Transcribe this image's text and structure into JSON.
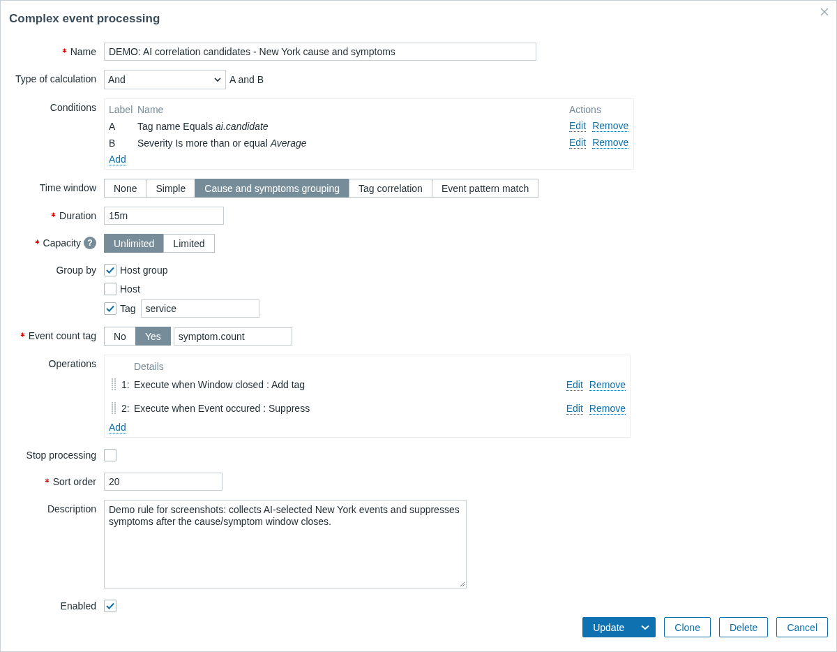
{
  "dialog": {
    "title": "Complex event processing"
  },
  "name": {
    "label": "Name",
    "required": true,
    "value": "DEMO: AI correlation candidates - New York cause and symptoms"
  },
  "calculation": {
    "label": "Type of calculation",
    "required": false,
    "value": "And",
    "formula": "A and B"
  },
  "conditions": {
    "label": "Conditions",
    "required": false,
    "columns": [
      "Label",
      "Name",
      "Actions"
    ],
    "rows": [
      {
        "label": "A",
        "name": "Tag name Equals *ai.candidate*",
        "actions": [
          "Edit",
          "Remove"
        ]
      },
      {
        "label": "B",
        "name": "Severity Is more than or equal *Average*",
        "actions": [
          "Edit",
          "Remove"
        ]
      }
    ],
    "add": "Add"
  },
  "time_window": {
    "label": "Time window",
    "required": false,
    "options": [
      {
        "label": "None",
        "selected": false
      },
      {
        "label": "Simple",
        "selected": false
      },
      {
        "label": "Cause and symptoms grouping",
        "selected": true
      },
      {
        "label": "Tag correlation",
        "selected": false
      },
      {
        "label": "Event pattern match",
        "selected": false
      }
    ]
  },
  "duration": {
    "label": "Duration",
    "required": true,
    "value": "15m"
  },
  "capacity": {
    "label": "Capacity",
    "required": true,
    "help": "?",
    "options": [
      {
        "label": "Unlimited",
        "selected": true
      },
      {
        "label": "Limited",
        "selected": false
      }
    ]
  },
  "group_by": {
    "label": "Group by",
    "required": false,
    "items": [
      {
        "label": "Host group",
        "checked": true
      },
      {
        "label": "Host",
        "checked": false
      },
      {
        "label": "Tag",
        "checked": true,
        "value": "service"
      }
    ]
  },
  "event_count_tag": {
    "label": "Event count tag",
    "required": true,
    "options": [
      {
        "label": "No",
        "selected": false
      },
      {
        "label": "Yes",
        "selected": true
      }
    ],
    "value": "symptom.count"
  },
  "operations": {
    "label": "Operations",
    "required": false,
    "columns": [
      "Details"
    ],
    "rows": [
      {
        "number": "1:",
        "details": "Execute when Window closed : Add tag",
        "actions": [
          "Edit",
          "Remove"
        ]
      },
      {
        "number": "2:",
        "details": "Execute when Event occured : Suppress",
        "actions": [
          "Edit",
          "Remove"
        ]
      }
    ],
    "add": "Add"
  },
  "stop_processing": {
    "label": "Stop processing",
    "required": false,
    "checked": false
  },
  "sort_order": {
    "label": "Sort order",
    "required": true,
    "value": "20"
  },
  "description": {
    "label": "Description",
    "required": false,
    "value": "Demo rule for screenshots: collects AI-selected New York events and suppresses symptoms after the cause/symptom window closes."
  },
  "enabled": {
    "label": "Enabled",
    "required": false,
    "checked": true
  },
  "buttons": [
    {
      "label": "Update",
      "kind": "primary"
    },
    {
      "label": "Clone",
      "kind": "secondary"
    },
    {
      "label": "Delete",
      "kind": "secondary"
    },
    {
      "label": "Cancel",
      "kind": "secondary"
    }
  ]
}
